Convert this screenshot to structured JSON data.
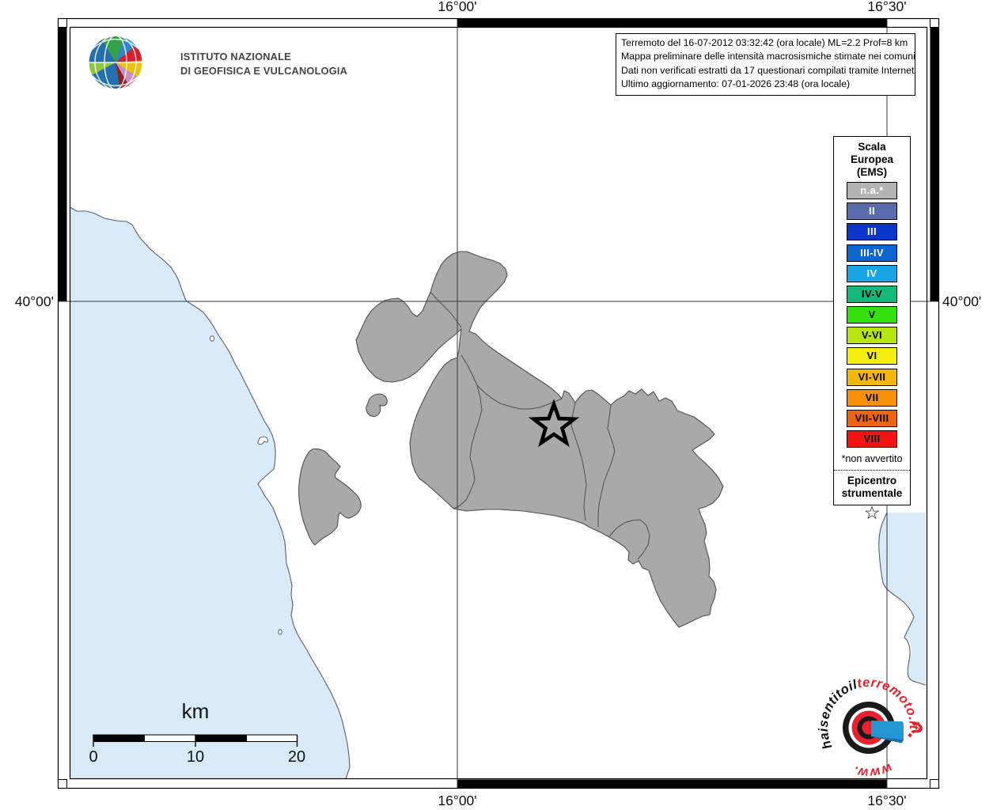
{
  "header": {
    "org_line1": "ISTITUTO NAZIONALE",
    "org_line2": "DI GEOFISICA E VULCANOLOGIA"
  },
  "info_box": {
    "lines": [
      "Terremoto del 16-07-2012 03:32:42 (ora locale) ML=2.2 Prof=8 km",
      "Mappa preliminare delle intensità macrosismiche stimate nei comuni",
      "Dati non verificati estratti da 17 questionari compilati tramite Internet.",
      "Ultimo aggiornamento: 07-01-2026 23:48 (ora locale)"
    ]
  },
  "graticule": {
    "meridian_labels": [
      "16°00'",
      "16°30'"
    ],
    "parallel_label": "40°00'"
  },
  "legend": {
    "title_lines": [
      "Scala",
      "Europea",
      "(EMS)"
    ],
    "items": [
      {
        "label": "n.a.*",
        "color": "#b3b3b3",
        "text_color": "#ffffff"
      },
      {
        "label": "II",
        "color": "#5a6cae",
        "text_color": "#ffffff"
      },
      {
        "label": "III",
        "color": "#0c35c9",
        "text_color": "#ffffff"
      },
      {
        "label": "III-IV",
        "color": "#0d66d0",
        "text_color": "#ffffff"
      },
      {
        "label": "IV",
        "color": "#19a5e5",
        "text_color": "#ffffff"
      },
      {
        "label": "IV-V",
        "color": "#17b97b",
        "text_color": "#000000"
      },
      {
        "label": "V",
        "color": "#35e00f",
        "text_color": "#000000"
      },
      {
        "label": "V-VI",
        "color": "#b8e412",
        "text_color": "#000000"
      },
      {
        "label": "VI",
        "color": "#f5ef10",
        "text_color": "#000000"
      },
      {
        "label": "VI-VII",
        "color": "#f3b70c",
        "text_color": "#000000"
      },
      {
        "label": "VII",
        "color": "#f49109",
        "text_color": "#000000"
      },
      {
        "label": "VII-VIII",
        "color": "#ef6411",
        "text_color": "#000000"
      },
      {
        "label": "VIII",
        "color": "#f21411",
        "text_color": "#000000"
      }
    ],
    "footnote": "*non avvertito",
    "epicenter_title_lines": [
      "Epicentro",
      "strumentale"
    ],
    "epicenter_symbol": "☆"
  },
  "scalebar": {
    "title": "km",
    "tick_labels": [
      "0",
      "10",
      "20"
    ]
  },
  "branding": {
    "www": "www.",
    "hai": "haisentito",
    "il": "il",
    "terremoto": "terremoto.it",
    "question_mark": "?"
  },
  "colors": {
    "sea": "#d9ebf8",
    "land_na": "#a9a9a9",
    "coast": "#5a6068",
    "boundary": "#585858",
    "grid": "#3a3a3a",
    "logo_red": "#e8212e",
    "logo_blue": "#2596d1",
    "logo_black": "#1a1a1a"
  }
}
